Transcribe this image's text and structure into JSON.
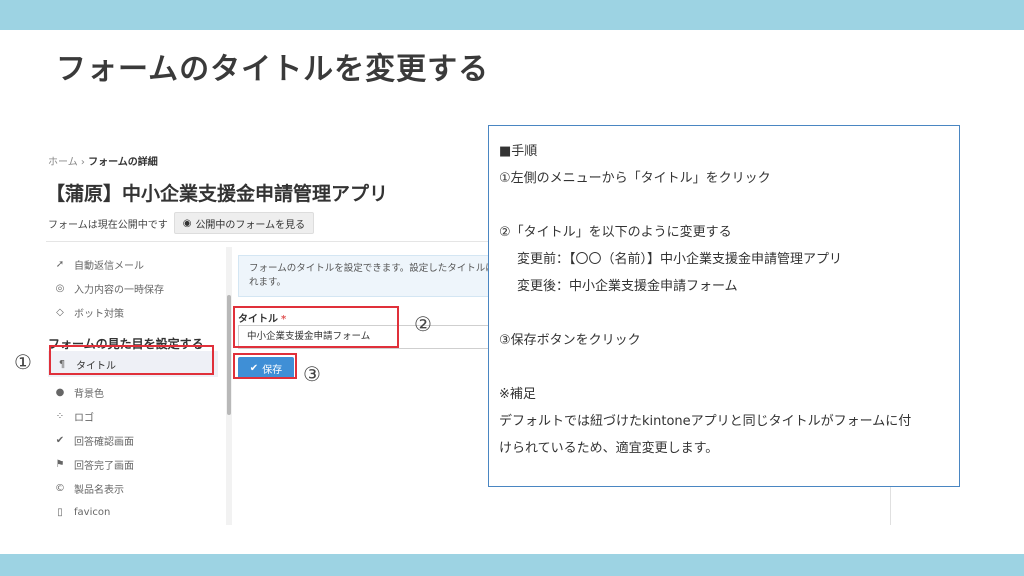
{
  "slide": {
    "title": "フォームのタイトルを変更する"
  },
  "screen": {
    "breadcrumb": {
      "home": "ホーム",
      "separator": "›",
      "current": "フォームの詳細"
    },
    "app_title": "【蒲原】中小企業支援金申請管理アプリ",
    "public_status": "フォームは現在公開中です",
    "public_button": "公開中のフォームを見る",
    "sidebar": {
      "top_items": [
        {
          "icon": "paper-plane-icon",
          "label": "自動返信メール"
        },
        {
          "icon": "save-icon",
          "label": "入力内容の一時保存"
        },
        {
          "icon": "shield-icon",
          "label": "ボット対策"
        }
      ],
      "section_header": "フォームの見た目を設定する",
      "active_item": {
        "icon": "title-icon",
        "label": "タイトル"
      },
      "items": [
        {
          "icon": "drop-icon",
          "label": "背景色"
        },
        {
          "icon": "logo-icon",
          "label": "ロゴ"
        },
        {
          "icon": "check-icon",
          "label": "回答確認画面"
        },
        {
          "icon": "flag-icon",
          "label": "回答完了画面"
        },
        {
          "icon": "count-icon",
          "label": "製品名表示"
        },
        {
          "icon": "bookmark-icon",
          "label": "favicon"
        }
      ]
    },
    "info_text_line1": "フォームのタイトルを設定できます。設定したタイトルは",
    "info_text_line2": "れます。",
    "field": {
      "label": "タイトル",
      "required_mark": "*",
      "value": "中小企業支援金申請フォーム"
    },
    "save_button": "保存"
  },
  "callouts": {
    "one": "①",
    "two": "②",
    "three": "③"
  },
  "colors": {
    "band": "#9dd3e3",
    "highlight": "#e0303a",
    "note_border": "#4a86c2",
    "save_button": "#3f8fd6"
  },
  "note": {
    "heading": "■手順",
    "step1": "①左側のメニューから「タイトル」をクリック",
    "step2": "②「タイトル」を以下のように変更する",
    "before": "変更前：【〇〇（名前）】中小企業支援金申請管理アプリ",
    "after": "変更後：中小企業支援金申請フォーム",
    "step3": "③保存ボタンをクリック",
    "supplement": "※補足",
    "supplement_line1": "デフォルトでは紐づけたkintoneアプリと同じタイトルがフォームに付",
    "supplement_line2": "けられているため、適宜変更します。"
  }
}
